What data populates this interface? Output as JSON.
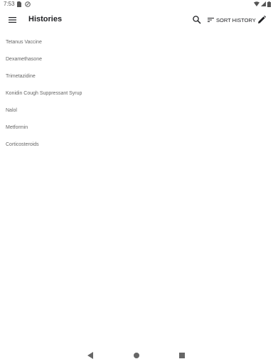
{
  "status_bar": {
    "time": "7:53",
    "icons": [
      "sim-card-icon",
      "notification-icon",
      "wifi-icon",
      "signal-icon",
      "battery-icon"
    ]
  },
  "toolbar": {
    "title": "Histories",
    "sort_label": "SORT HISTORY",
    "icons": [
      "menu-icon",
      "search-icon",
      "sort-icon",
      "edit-icon"
    ]
  },
  "histories": [
    {
      "label": "Tetanus Vaccine"
    },
    {
      "label": "Dexamethasone"
    },
    {
      "label": "Trimetazidine"
    },
    {
      "label": "Konidin Cough Suppressant Syrup"
    },
    {
      "label": "Nalol"
    },
    {
      "label": "Metformin"
    },
    {
      "label": "Corticosteroids"
    }
  ],
  "nav_bar": {
    "icons": [
      "back-icon",
      "home-icon",
      "recents-icon"
    ]
  },
  "colors": {
    "background": "#ffffff",
    "text_primary": "#202124",
    "text_secondary": "#666666"
  }
}
